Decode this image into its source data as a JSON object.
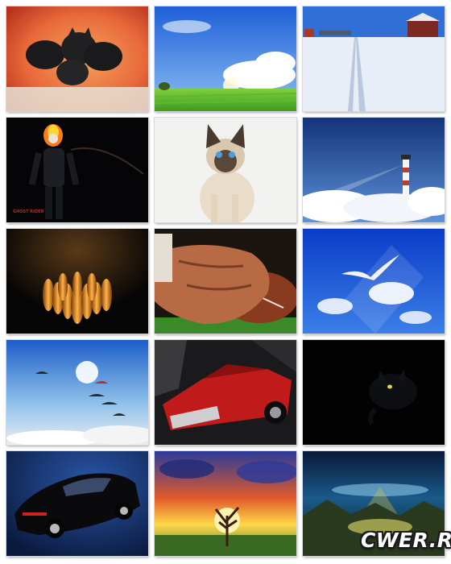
{
  "gallery": {
    "tiles": [
      {
        "subject": "black kittens on red blanket"
      },
      {
        "subject": "green field under blue sky"
      },
      {
        "subject": "snowy road with red barn"
      },
      {
        "subject": "ghost rider"
      },
      {
        "subject": "siamese kitten"
      },
      {
        "subject": "lighthouse above clouds"
      },
      {
        "subject": "glowing bowling pins"
      },
      {
        "subject": "hands holding football"
      },
      {
        "subject": "seagull in blue sky"
      },
      {
        "subject": "parachutists in sky"
      },
      {
        "subject": "red classic car"
      },
      {
        "subject": "black cat in darkness"
      },
      {
        "subject": "black sports car"
      },
      {
        "subject": "tree at sunset"
      },
      {
        "subject": "fantasy landscape with light"
      }
    ],
    "ghost_rider_caption": "GHOST RIDER"
  },
  "watermark": {
    "text": "CWER.RU"
  }
}
